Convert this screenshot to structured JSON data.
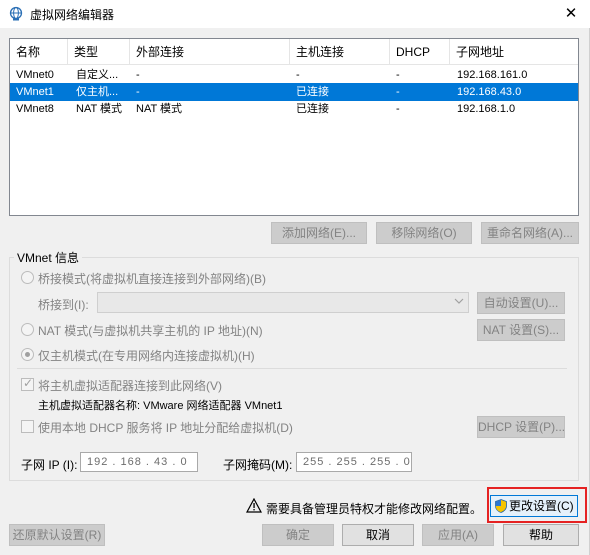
{
  "window": {
    "title": "虚拟网络编辑器",
    "close_glyph": "✕"
  },
  "table": {
    "columns": [
      "名称",
      "类型",
      "外部连接",
      "主机连接",
      "DHCP",
      "子网地址"
    ],
    "rows": [
      {
        "name": "VMnet0",
        "type": "自定义...",
        "external": "-",
        "host": "-",
        "dhcp": "-",
        "subnet": "192.168.161.0",
        "selected": false
      },
      {
        "name": "VMnet1",
        "type": "仅主机...",
        "external": "-",
        "host": "已连接",
        "dhcp": "-",
        "subnet": "192.168.43.0",
        "selected": true
      },
      {
        "name": "VMnet8",
        "type": "NAT 模式",
        "external": "NAT 模式",
        "host": "已连接",
        "dhcp": "-",
        "subnet": "192.168.1.0",
        "selected": false
      }
    ]
  },
  "list_buttons": {
    "add": "添加网络(E)...",
    "remove": "移除网络(O)",
    "rename": "重命名网络(A)..."
  },
  "vmnet_info": {
    "label": "VMnet 信息",
    "bridge_mode": "桥接模式(将虚拟机直接连接到外部网络)(B)",
    "bridge_to": "桥接到(I):",
    "auto_settings": "自动设置(U)...",
    "nat_mode": "NAT 模式(与虚拟机共享主机的 IP 地址)(N)",
    "nat_settings": "NAT 设置(S)...",
    "host_only": "仅主机模式(在专用网络内连接虚拟机)(H)",
    "connect_adapter": "将主机虚拟适配器连接到此网络(V)",
    "adapter_name": "主机虚拟适配器名称: VMware 网络适配器 VMnet1",
    "use_dhcp": "使用本地 DHCP 服务将 IP 地址分配给虚拟机(D)",
    "dhcp_settings": "DHCP 设置(P)...",
    "subnet_ip_label": "子网 IP (I):",
    "subnet_ip_value": "192 . 168 . 43 . 0",
    "subnet_mask_label": "子网掩码(M):",
    "subnet_mask_value": "255 . 255 . 255 . 0"
  },
  "admin_notice": "需要具备管理员特权才能修改网络配置。",
  "change_settings": "更改设置(C)",
  "footer": {
    "restore": "还原默认设置(R)",
    "ok": "确定",
    "cancel": "取消",
    "apply": "应用(A)",
    "help": "帮助"
  },
  "colors": {
    "selection": "#0078d7",
    "highlight_box": "#e52222"
  }
}
